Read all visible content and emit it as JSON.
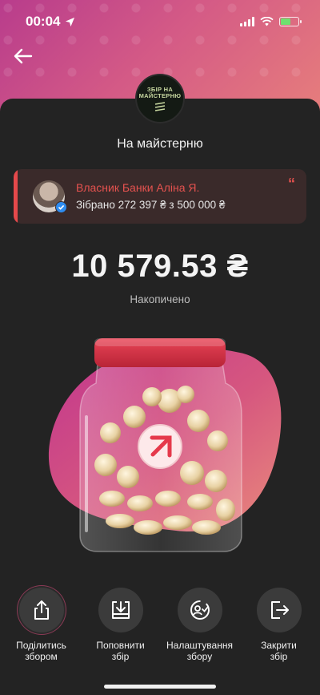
{
  "status_bar": {
    "time": "00:04"
  },
  "logo": {
    "text": "ЗБІР НА\nМАЙСТЕРНЮ"
  },
  "jar": {
    "title": "На майстерню",
    "balance": "10 579.53 ₴",
    "balance_label": "Накопичено"
  },
  "owner": {
    "name": "Власник Банки Аліна Я.",
    "collected": "Зібрано 272 397 ₴ з 500 000 ₴",
    "quote_mark": "“"
  },
  "actions": [
    {
      "label": "Поділитись\nзбором",
      "icon": "share-icon"
    },
    {
      "label": "Поповнити\nзбір",
      "icon": "top-up-icon"
    },
    {
      "label": "Налаштування\nзбору",
      "icon": "settings-icon"
    },
    {
      "label": "Закрити\nзбір",
      "icon": "close-jar-icon"
    }
  ],
  "colors": {
    "accent": "#e5494b",
    "background": "#232323",
    "hero_gradient_start": "#b83c8c",
    "hero_gradient_end": "#e8817b"
  }
}
